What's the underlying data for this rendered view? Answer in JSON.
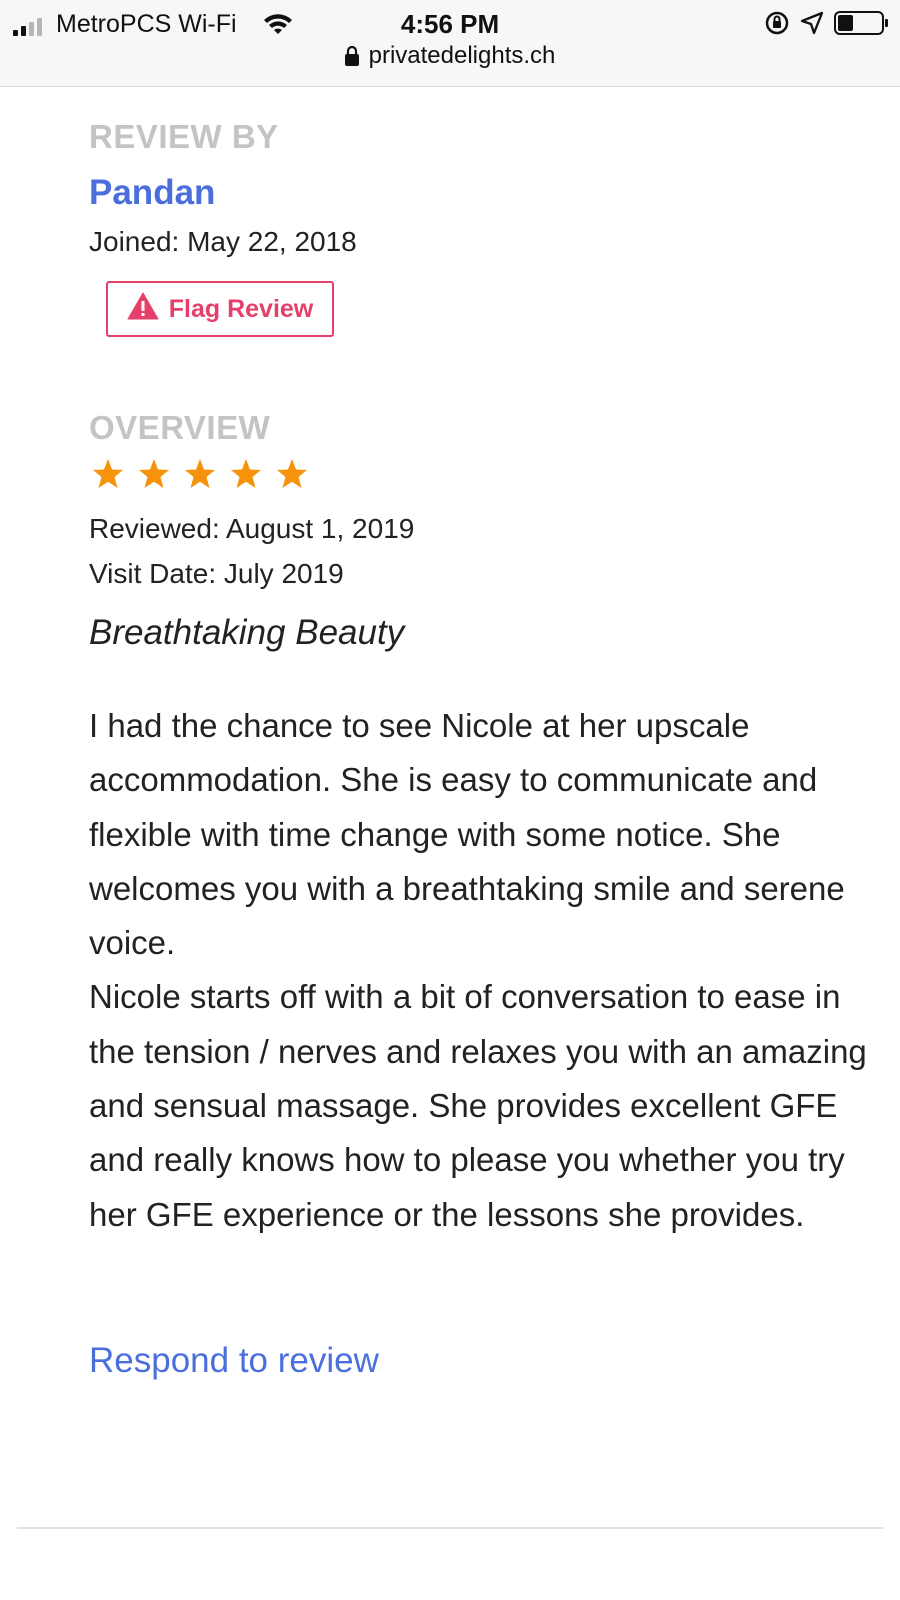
{
  "status_bar": {
    "carrier": "MetroPCS Wi-Fi",
    "time": "4:56 PM",
    "url": "privatedelights.ch",
    "icons": [
      "signal-icon",
      "wifi-icon",
      "orientation-lock-icon",
      "location-icon",
      "battery-icon"
    ]
  },
  "review": {
    "review_by_label": "REVIEW BY",
    "reviewer_name": "Pandan",
    "joined": "Joined: May 22, 2018",
    "flag_label": "Flag Review",
    "overview_label": "OVERVIEW",
    "rating": 5,
    "rating_max": 5,
    "reviewed": "Reviewed: August 1, 2019",
    "visit_date": "Visit Date: July 2019",
    "title": "Breathtaking Beauty",
    "body": [
      "I had the chance to see Nicole at her upscale accommodation. She is easy to communicate and flexible with time change with some notice. She welcomes you with a breathtaking smile and serene voice.",
      "Nicole starts off with a bit of conversation to ease in the tension / nerves and relaxes you with an amazing and sensual massage. She provides excellent GFE and really knows how to please you whether you try her GFE experience or the lessons she provides."
    ],
    "respond_label": "Respond to review"
  },
  "colors": {
    "link": "#4a6fdc",
    "flag": "#e5406a",
    "star": "#f5930a",
    "section_label": "#c4c4c4"
  }
}
